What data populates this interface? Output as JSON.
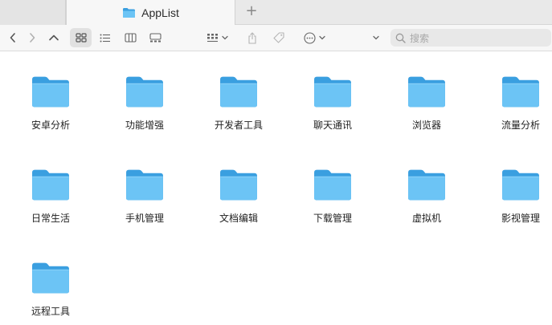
{
  "window": {
    "tab_title": "AppList",
    "new_tab_symbol": "+"
  },
  "toolbar": {
    "search_placeholder": "搜索",
    "icons": [
      "chevron-left-icon",
      "chevron-right-icon",
      "chevron-up-icon",
      "grid-view-icon",
      "list-view-icon",
      "column-view-icon",
      "gallery-view-icon",
      "group-icon",
      "share-icon",
      "tag-icon",
      "more-icon",
      "dropdown-icon",
      "search-icon"
    ]
  },
  "folders": [
    {
      "label": "安卓分析"
    },
    {
      "label": "功能增强"
    },
    {
      "label": "开发者工具"
    },
    {
      "label": "聊天通讯"
    },
    {
      "label": "浏览器"
    },
    {
      "label": "流量分析"
    },
    {
      "label": "日常生活"
    },
    {
      "label": "手机管理"
    },
    {
      "label": "文档编辑"
    },
    {
      "label": "下载管理"
    },
    {
      "label": "虚拟机"
    },
    {
      "label": "影视管理"
    },
    {
      "label": "远程工具"
    }
  ],
  "colors": {
    "folder_front": "#6cc4f5",
    "folder_back": "#3a9fe0",
    "folder_tab": "#3a9fe0"
  }
}
